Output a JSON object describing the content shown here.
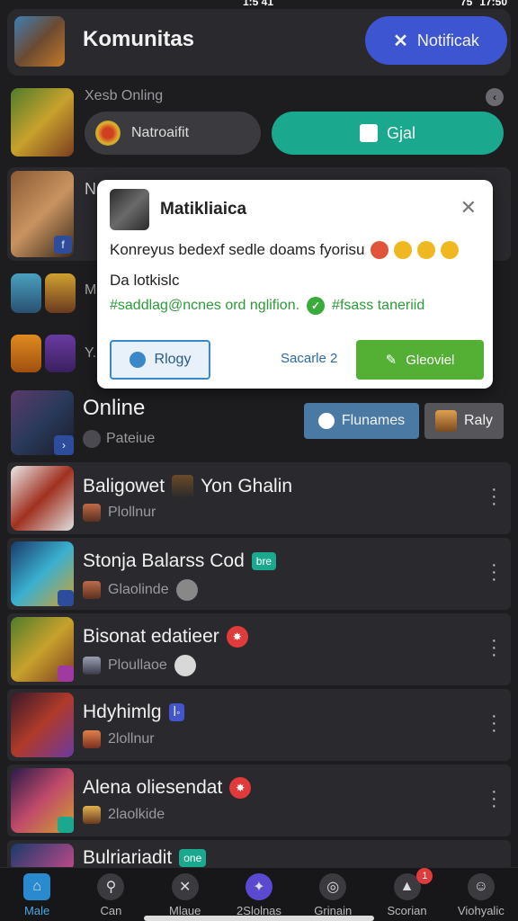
{
  "status": {
    "time": "1:5 41",
    "battery": "75",
    "clock": "17:50"
  },
  "header": {
    "title": "Komunitas",
    "notif_label": "Notificak"
  },
  "row1": {
    "sub_label": "Xesb Onling",
    "grey_pill": "Natroaifit",
    "teal_pill": "Gjal"
  },
  "row2": {
    "letter": "N"
  },
  "row3": {
    "label": "M"
  },
  "row4": {
    "label": "Y."
  },
  "popup": {
    "title": "Matikliaica",
    "line1": "Konreyus bedexf sedle doams fyorisu",
    "line2": "Da lotkislc",
    "line3a": "#saddlag@ncnes ord nglifion.",
    "line3b": "#fsass taneriid",
    "btn_outline": "Rlogy",
    "link": "Sacarle  2",
    "btn_green": "Gleoviel"
  },
  "online": {
    "title": "Online",
    "sub": "Pateiue",
    "btn1": "Flunames",
    "btn2": "Raly"
  },
  "items": [
    {
      "name": "Baligowet",
      "extra": "Yon Ghalin",
      "meta": "Plollnur"
    },
    {
      "name": "Stonja Balarss Cod",
      "tag": "bre",
      "meta": "Glaolinde"
    },
    {
      "name": "Bisonat edatieer",
      "meta": "Ploullaoe"
    },
    {
      "name": "Hdyhimlg",
      "meta": "2lollnur"
    },
    {
      "name": "Alena oliesendat",
      "meta": "2laolkide"
    },
    {
      "name": "Bulriariadit",
      "tag": "one"
    }
  ],
  "tabs": [
    {
      "label": "Male"
    },
    {
      "label": "Can"
    },
    {
      "label": "Mlaue"
    },
    {
      "label": "2Slolnas"
    },
    {
      "label": "Grinain"
    },
    {
      "label": "Scorian",
      "badge": "1"
    },
    {
      "label": "Viohyalic"
    }
  ],
  "colors": {
    "accent": "#3d55d0",
    "teal": "#1aa88f",
    "green": "#54b035",
    "background": "#1d1d20"
  }
}
